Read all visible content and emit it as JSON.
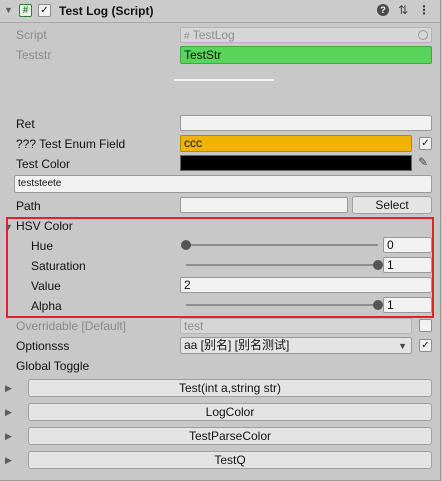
{
  "header": {
    "script_icon": "#",
    "enabled_check": "✓",
    "title": "Test Log (Script)",
    "help_icon": "?",
    "preset_icon": "⇅",
    "menu_icon": "⋮"
  },
  "script_row": {
    "label": "Script",
    "value": "TestLog",
    "file_icon": "#"
  },
  "teststr_row": {
    "label": "Teststr",
    "value": "TestStr"
  },
  "ret_row": {
    "label": "Ret",
    "value": ""
  },
  "enum_row": {
    "label": "??? Test Enum Field",
    "value": "ccc",
    "checked": "✓"
  },
  "color_row": {
    "label": "Test Color",
    "picker_icon": "✎"
  },
  "textarea": {
    "value": "teststeete"
  },
  "path_row": {
    "label": "Path",
    "value": "",
    "button": "Select"
  },
  "hsv": {
    "title": "HSV Color",
    "hue": {
      "label": "Hue",
      "value": "0",
      "fraction": 0
    },
    "saturation": {
      "label": "Saturation",
      "value": "1",
      "fraction": 1
    },
    "value": {
      "label": "Value",
      "value": "2"
    },
    "alpha": {
      "label": "Alpha",
      "value": "1",
      "fraction": 1
    }
  },
  "overridable_row": {
    "label": "Overridable [Default]",
    "value": "test"
  },
  "options_row": {
    "label": "Optionsss",
    "value": "aa [别名] [别名测试]",
    "checked": "✓"
  },
  "global_toggle": {
    "label": "Global Toggle"
  },
  "buttons": [
    {
      "label": "Test(int a,string str)"
    },
    {
      "label": "LogColor"
    },
    {
      "label": "TestParseColor"
    },
    {
      "label": "TestQ"
    }
  ],
  "colors": {
    "accent_green": "#5ad45a",
    "enum_yellow": "#f0b400",
    "hsv_highlight": "#e0222a",
    "test_color": "#000000"
  }
}
